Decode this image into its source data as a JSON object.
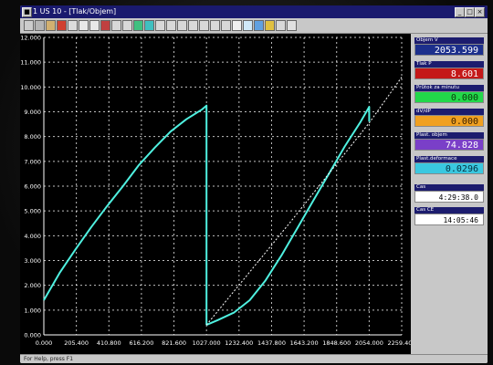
{
  "window": {
    "title": "1 US 10 - [Tlak/Objem]"
  },
  "panel": {
    "readouts": [
      {
        "label": "Objem V",
        "value": "2053.599",
        "bg": "#1c2f8c",
        "fg": "#ffffff",
        "lblbg": "#1c1c6e"
      },
      {
        "label": "Tlak P",
        "value": "8.601",
        "bg": "#c41818",
        "fg": "#ffffff",
        "lblbg": "#1c1c6e"
      },
      {
        "label": "Průtok za minutu",
        "value": "0.000",
        "bg": "#22d84a",
        "fg": "#0a3a0a",
        "lblbg": "#1c1c6e"
      },
      {
        "label": "dV/dP",
        "value": "0.000",
        "bg": "#f0a020",
        "fg": "#3a2000",
        "lblbg": "#1c1c6e"
      },
      {
        "label": "Plast. objem",
        "value": "74.828",
        "bg": "#7a3fc8",
        "fg": "#ffffff",
        "lblbg": "#1c1c6e"
      },
      {
        "label": "Plast.deformace",
        "value": "0.0296",
        "bg": "#3ac8e0",
        "fg": "#063040",
        "lblbg": "#1c1c6e"
      },
      {
        "label": "Cas",
        "value": "4:29:38.0",
        "bg": "#ffffff",
        "fg": "#000000",
        "lblbg": "#1c1c6e"
      },
      {
        "label": "Cas CE",
        "value": "14:05:46",
        "bg": "#ffffff",
        "fg": "#000000",
        "lblbg": "#1c1c6e"
      }
    ]
  },
  "status": {
    "text": "For Help, press F1"
  },
  "chart_data": {
    "type": "line",
    "xticks": [
      "0.000",
      "205.400",
      "410.800",
      "616.200",
      "821.600",
      "1027.000",
      "1232.400",
      "1437.800",
      "1643.200",
      "1848.600",
      "2054.000",
      "2259.400"
    ],
    "yticks": [
      "0.000",
      "1.000",
      "2.000",
      "3.000",
      "4.000",
      "5.000",
      "6.000",
      "7.000",
      "8.000",
      "9.000",
      "10.000",
      "11.000",
      "12.000"
    ],
    "xlim": [
      0,
      2259.4
    ],
    "ylim": [
      0,
      12
    ],
    "grid": true,
    "colors": {
      "series": "#4ff0e0",
      "reference": "#ffffff",
      "grid": "#ffffff",
      "tick": "#ffffff"
    },
    "series": [
      {
        "x": [
          0,
          100,
          200,
          300,
          400,
          500,
          600,
          700,
          800,
          900,
          1000,
          1027,
          1027
        ],
        "y": [
          1.4,
          2.5,
          3.45,
          4.35,
          5.2,
          6.0,
          6.85,
          7.55,
          8.2,
          8.7,
          9.1,
          9.25,
          0.4
        ]
      },
      {
        "x": [
          1027,
          1100,
          1200,
          1300,
          1400,
          1500,
          1600,
          1700,
          1800,
          1900,
          2000,
          2054,
          2054
        ],
        "y": [
          0.4,
          0.6,
          0.9,
          1.4,
          2.2,
          3.2,
          4.3,
          5.4,
          6.5,
          7.6,
          8.6,
          9.2,
          8.6
        ]
      },
      {
        "x": [
          1027,
          1550,
          2054,
          2259.4
        ],
        "y": [
          0.4,
          4.5,
          8.55,
          10.4
        ]
      }
    ]
  }
}
